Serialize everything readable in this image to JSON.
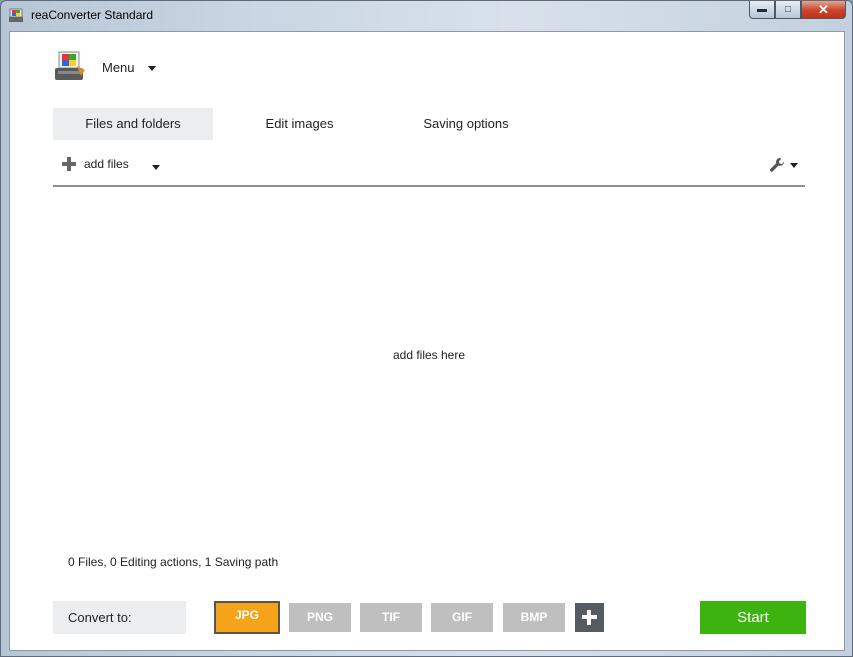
{
  "window": {
    "title": "reaConverter Standard"
  },
  "menu": {
    "label": "Menu"
  },
  "tabs": [
    {
      "label": "Files and folders",
      "active": true
    },
    {
      "label": "Edit images",
      "active": false
    },
    {
      "label": "Saving options",
      "active": false
    }
  ],
  "toolbar": {
    "add_files_label": "add files"
  },
  "dropzone": {
    "text": "add files here"
  },
  "summary": "0 Files,  0 Editing actions,  1 Saving path",
  "convert": {
    "label": "Convert to:",
    "formats": [
      "JPG",
      "PNG",
      "TIF",
      "GIF",
      "BMP"
    ],
    "selected": "JPG"
  },
  "start": {
    "label": "Start"
  },
  "colors": {
    "selected_format": "#f5a31a",
    "start": "#3cb30e",
    "format_inactive": "#bfbfbf"
  }
}
